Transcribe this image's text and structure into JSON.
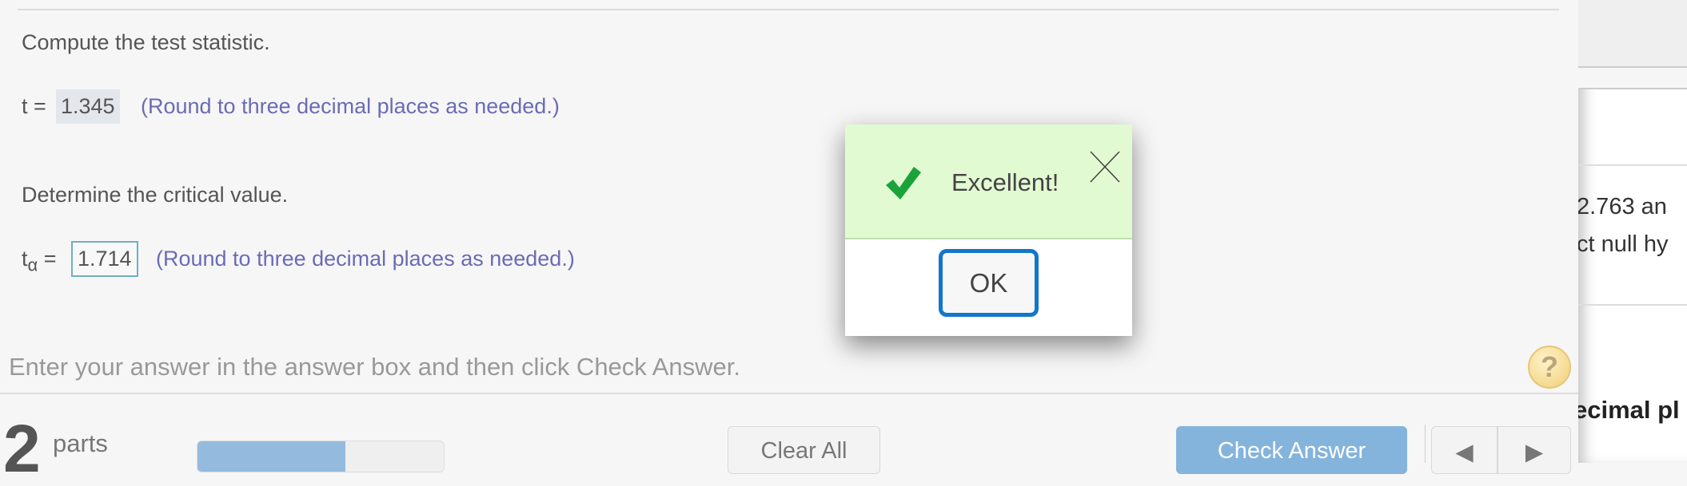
{
  "question": {
    "part1_prompt": "Compute the test statistic.",
    "part1_label": "t =",
    "part1_value": "1.345",
    "part1_hint": "(Round to three decimal places as needed.)",
    "part2_prompt": "Determine the critical value.",
    "part2_label": "t",
    "part2_subscript": "α",
    "part2_equals": "=",
    "part2_value": "1.714",
    "part2_hint": "(Round to three decimal places as needed.)"
  },
  "instruction": "Enter your answer in the answer box and then click Check Answer.",
  "help_icon": "question-mark-icon",
  "footer": {
    "parts_count": "2",
    "parts_label": "parts",
    "progress_percent": 60,
    "clear_all_label": "Clear All",
    "check_answer_label": "Check Answer",
    "check_answer_color": "#84b4dc"
  },
  "side_panel": {
    "line1": "2.763 an",
    "line2": "ct null hy",
    "line3": "ecimal pl"
  },
  "dialog": {
    "message": "Excellent!",
    "ok_label": "OK",
    "success_color": "#1aa33a",
    "header_bg": "#e2fad2",
    "ok_border_color": "#1276cc"
  }
}
